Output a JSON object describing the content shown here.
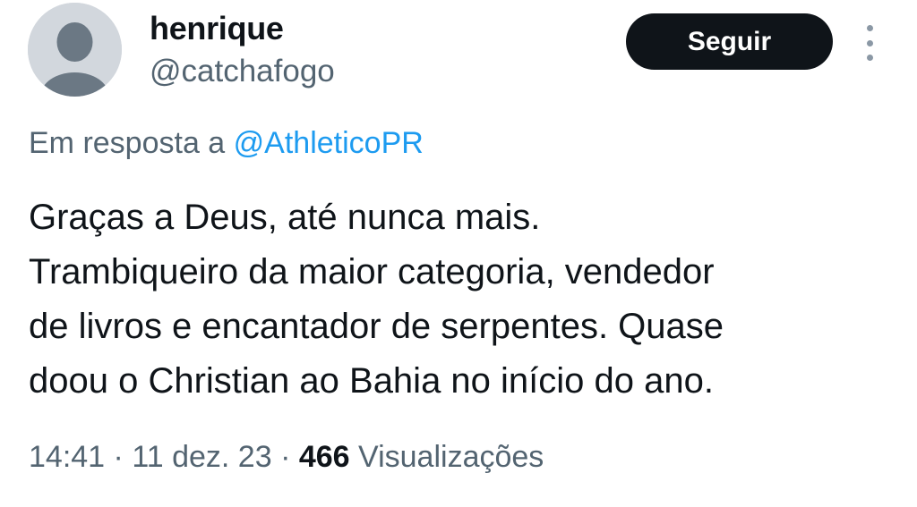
{
  "author": {
    "display_name": "henrique",
    "handle": "@catchafogo",
    "avatar_icon": "default-avatar-silhouette-icon"
  },
  "follow_button": {
    "label": "Seguir"
  },
  "more_menu": {
    "icon": "vertical-ellipsis-icon"
  },
  "reply": {
    "prefix": "Em resposta a",
    "mention": "@AthleticoPR"
  },
  "tweet": {
    "lines": [
      "Graças a Deus, até nunca mais.",
      "Trambiqueiro da maior categoria, vendedor",
      "de livros e encantador de serpentes. Quase",
      "doou o Christian ao Bahia no início do ano."
    ]
  },
  "meta": {
    "time": "14:41",
    "separator": "·",
    "date": "11 dez. 23",
    "views_count": "466",
    "views_label": "Visualizações"
  },
  "colors": {
    "text_primary": "#0f1419",
    "text_secondary": "#536471",
    "link": "#1d9bf0",
    "button_bg": "#0f1419",
    "avatar_bg": "#d2d7dd"
  }
}
